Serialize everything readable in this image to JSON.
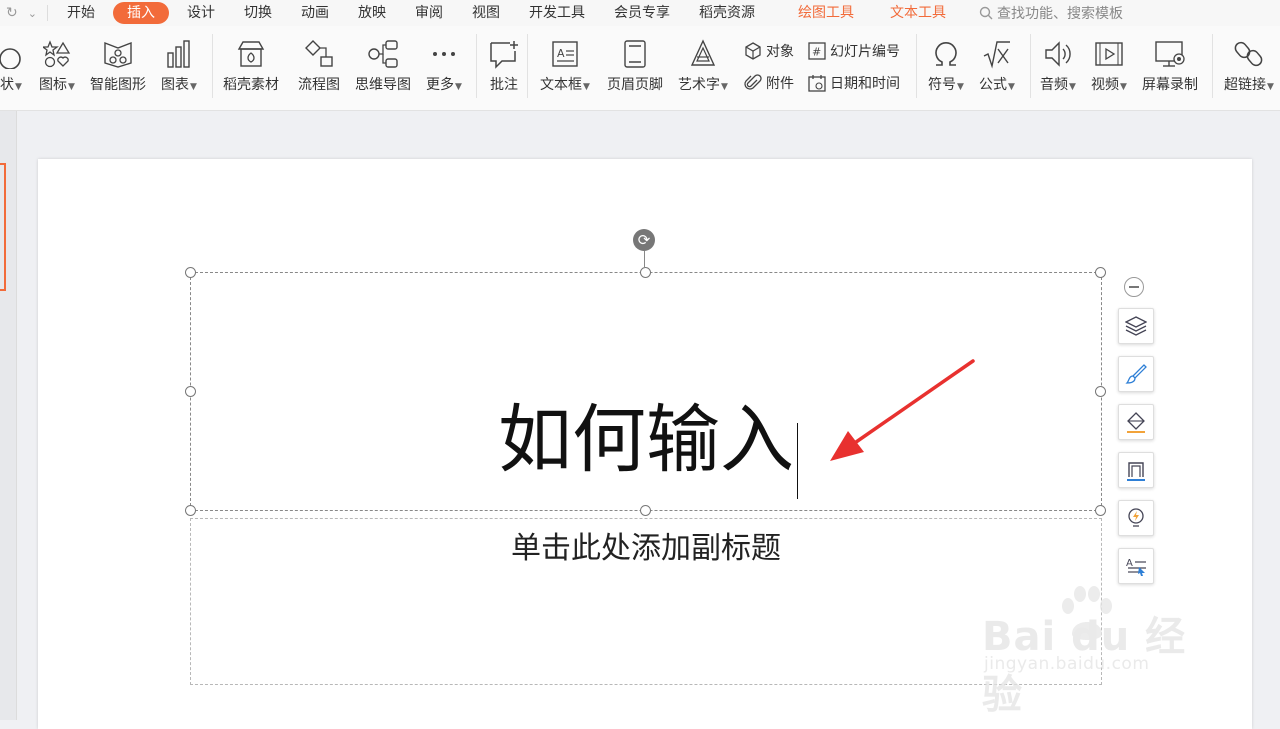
{
  "quick_access": {
    "redo_icon": "redo-icon",
    "dropdown_icon": "chevron-down-icon"
  },
  "menu": {
    "tabs": [
      "开始",
      "插入",
      "设计",
      "切换",
      "动画",
      "放映",
      "审阅",
      "视图",
      "开发工具",
      "会员专享",
      "稻壳资源"
    ],
    "active_tab": "插入",
    "context_tabs": [
      "绘图工具",
      "文本工具"
    ],
    "search_placeholder": "查找功能、搜索模板"
  },
  "ribbon": {
    "shapes": "状",
    "icons": "图标",
    "smartart": "智能图形",
    "chart": "图表",
    "docer_material": "稻壳素材",
    "flowchart": "流程图",
    "mindmap": "思维导图",
    "more": "更多",
    "comment": "批注",
    "textbox": "文本框",
    "header_footer": "页眉页脚",
    "wordart": "艺术字",
    "object": "对象",
    "slide_number": "幻灯片编号",
    "attachment": "附件",
    "date_time": "日期和时间",
    "symbol": "符号",
    "formula": "公式",
    "audio": "音频",
    "video": "视频",
    "screen_record": "屏幕录制",
    "hyperlink": "超链接"
  },
  "slide": {
    "title": "如何输入",
    "subtitle_placeholder": "单击此处添加副标题"
  },
  "colors": {
    "accent": "#f26b3a",
    "arrow": "#e8312f"
  },
  "watermark": {
    "brand": "Bai du 经验",
    "url": "jingyan.baidu.com"
  }
}
